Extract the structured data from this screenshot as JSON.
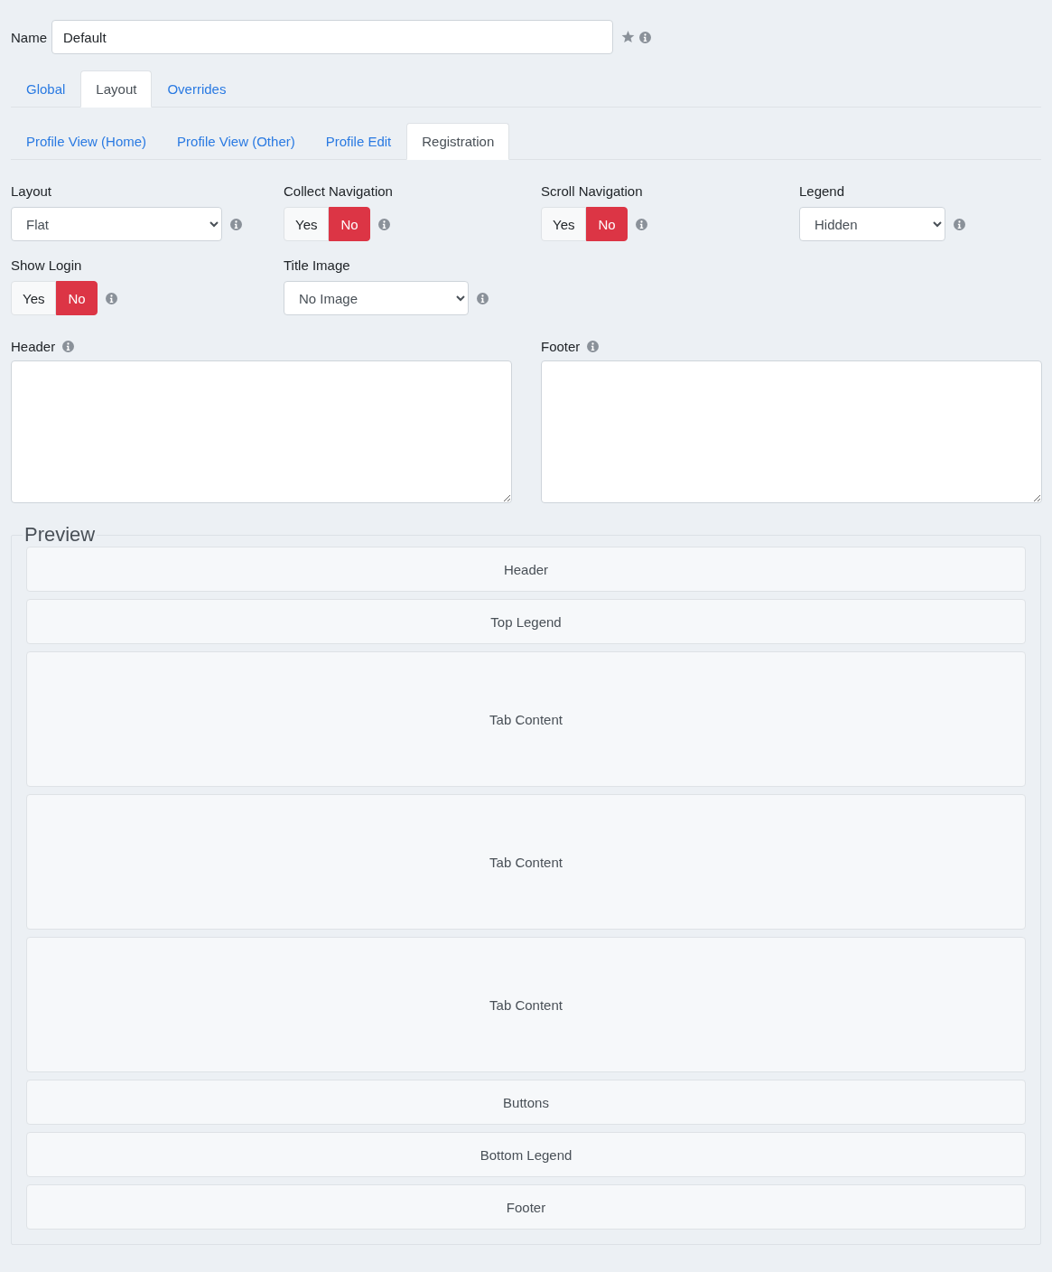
{
  "name_field": {
    "label": "Name",
    "value": "Default"
  },
  "tabs": [
    {
      "label": "Global",
      "selected": false
    },
    {
      "label": "Layout",
      "selected": true
    },
    {
      "label": "Overrides",
      "selected": false
    }
  ],
  "subtabs": [
    {
      "label": "Profile View (Home)",
      "selected": false
    },
    {
      "label": "Profile View (Other)",
      "selected": false
    },
    {
      "label": "Profile Edit",
      "selected": false
    },
    {
      "label": "Registration",
      "selected": true
    }
  ],
  "fields": [
    {
      "kind": "select",
      "label": "Layout",
      "value": "Flat"
    },
    {
      "kind": "toggle",
      "label": "Collect Navigation",
      "options": [
        {
          "label": "Yes",
          "selected": false
        },
        {
          "label": "No",
          "selected": true
        }
      ]
    },
    {
      "kind": "toggle",
      "label": "Scroll Navigation",
      "options": [
        {
          "label": "Yes",
          "selected": false
        },
        {
          "label": "No",
          "selected": true
        }
      ]
    },
    {
      "kind": "select",
      "label": "Legend",
      "value": "Hidden"
    },
    {
      "kind": "toggle",
      "label": "Show Login",
      "options": [
        {
          "label": "Yes",
          "selected": false
        },
        {
          "label": "No",
          "selected": true
        }
      ]
    },
    {
      "kind": "select",
      "label": "Title Image",
      "value": "No Image"
    }
  ],
  "text_areas": [
    {
      "label": "Header"
    },
    {
      "label": "Footer"
    }
  ],
  "preview": {
    "title": "Preview",
    "blocks": [
      {
        "label": "Header",
        "tall": false
      },
      {
        "label": "Top Legend",
        "tall": false
      },
      {
        "label": "Tab Content",
        "tall": true
      },
      {
        "label": "Tab Content",
        "tall": true
      },
      {
        "label": "Tab Content",
        "tall": true
      },
      {
        "label": "Buttons",
        "tall": false
      },
      {
        "label": "Bottom Legend",
        "tall": false
      },
      {
        "label": "Footer",
        "tall": false
      }
    ]
  }
}
